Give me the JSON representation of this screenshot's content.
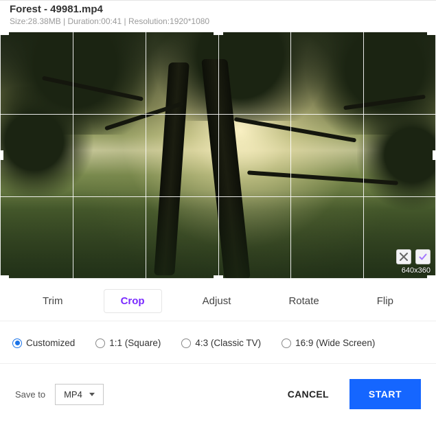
{
  "header": {
    "title": "Forest - 49981.mp4",
    "meta": "Size:28.38MB | Duration:00:41 | Resolution:1920*1080"
  },
  "preview": {
    "crop_size_label": "640x360"
  },
  "tabs": {
    "trim": "Trim",
    "crop": "Crop",
    "adjust": "Adjust",
    "rotate": "Rotate",
    "flip": "Flip",
    "active": "crop"
  },
  "aspects": {
    "customized": "Customized",
    "square": "1:1 (Square)",
    "classic": "4:3 (Classic TV)",
    "wide": "16:9 (Wide Screen)",
    "selected": "customized"
  },
  "footer": {
    "save_to_label": "Save to",
    "format_selected": "MP4",
    "cancel": "CANCEL",
    "start": "START"
  }
}
